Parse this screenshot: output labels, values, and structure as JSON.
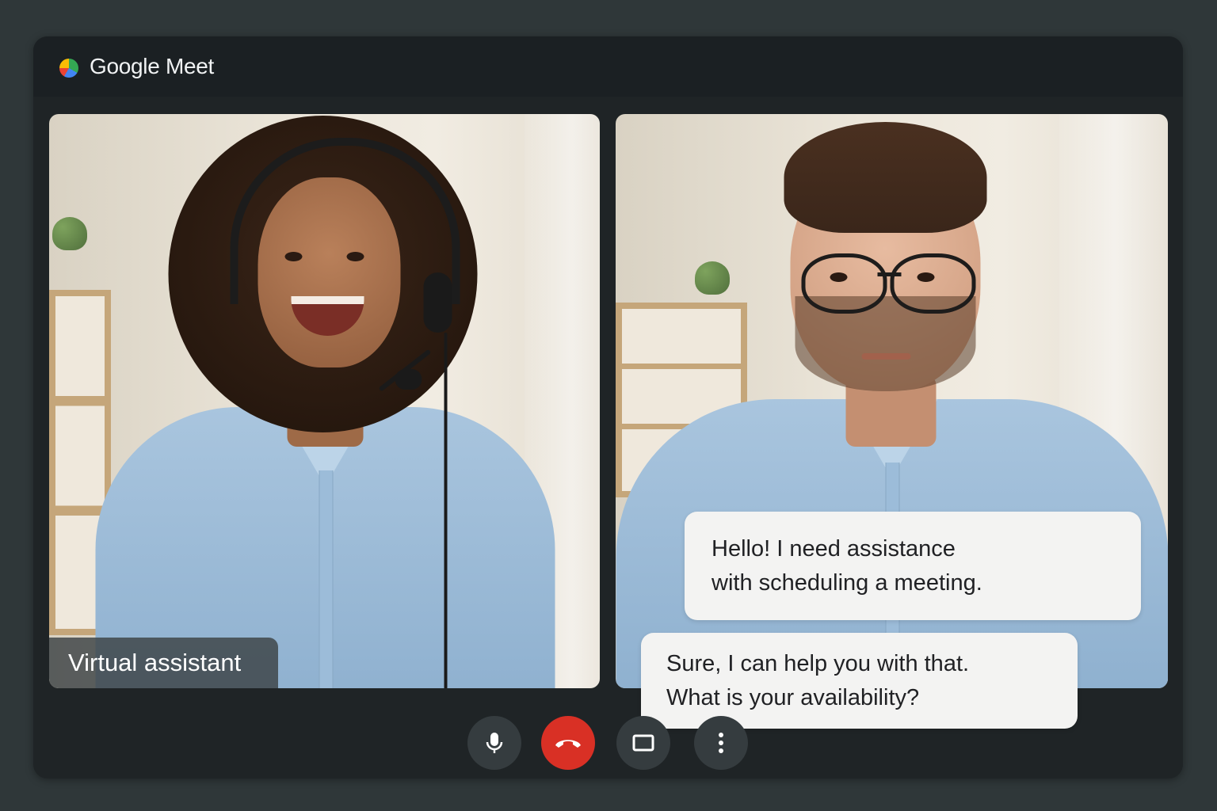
{
  "app": {
    "title": "Google Meet",
    "logo_icon": "google-meet-logo"
  },
  "participants": [
    {
      "name_label": "Virtual assistant"
    },
    {
      "name_label": ""
    }
  ],
  "chat": {
    "messages": [
      {
        "lines": [
          "Hello! I need assistance",
          "with scheduling a meeting."
        ]
      },
      {
        "lines": [
          "Sure, I can help you with that.",
          "What is your availability?"
        ]
      }
    ]
  },
  "controls": [
    {
      "icon": "microphone-icon",
      "color": "#353c3f"
    },
    {
      "icon": "end-call-icon",
      "color": "#d93025"
    },
    {
      "icon": "present-screen-icon",
      "color": "#353c3f"
    },
    {
      "icon": "more-options-icon",
      "color": "#353c3f"
    }
  ]
}
